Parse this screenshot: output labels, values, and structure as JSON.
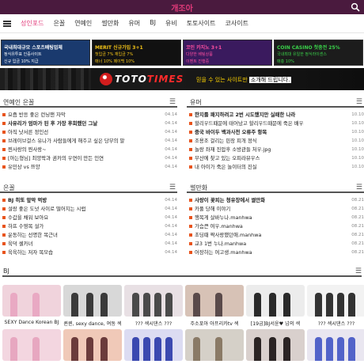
{
  "header": {
    "site_title": "개조아",
    "search_icon": "search-icon",
    "menu_icon": "hamburger-icon"
  },
  "nav": {
    "items": [
      {
        "label": "성인포드",
        "active": true
      },
      {
        "label": "은꼴",
        "active": false
      },
      {
        "label": "연예인",
        "active": false
      },
      {
        "label": "썰만화",
        "active": false
      },
      {
        "label": "유머",
        "active": false
      },
      {
        "label": "BJ",
        "active": false
      },
      {
        "label": "유비",
        "active": false
      },
      {
        "label": "토토사이트",
        "active": false
      },
      {
        "label": "코사이트",
        "active": false
      }
    ]
  },
  "banners": [
    {
      "l1": "국내최대규모 스포츠배팅업체",
      "l2": "정식유투표 인증사이트",
      "l3": "신규 입금 10% 지급",
      "bg": "#1a3a6e",
      "fg": "#ffffff"
    },
    {
      "l1": "MERIT 신규가입 3+1",
      "l2": "첫입금 7% 재입금 7%",
      "l3": "매너 10% 페이백 10%",
      "bg": "#111111",
      "fg": "#f5c518"
    },
    {
      "l1": "코인 카지노 3+1",
      "l2": "다양한 베팅상품",
      "l3": "이벤트 진행중",
      "bg": "#3a1a5e",
      "fg": "#ff4fa0"
    },
    {
      "l1": "COIN CASINO 첫충전 25%",
      "l2": "국내최대 유일한 정식라이센스",
      "l3": "매충 10%",
      "bg": "#1c1c1c",
      "fg": "#3ad24a"
    }
  ],
  "promo": {
    "brand_main": "TOTO",
    "brand_accent": "TIMES",
    "slogan_highlight": "믿을 수 있는 사이트만",
    "slogan_box": "소개해 드립니다."
  },
  "sections": {
    "celeb": {
      "title": "연예인 은꼴",
      "items": [
        {
          "title": "요즘 반응 좋은 런닝맨 자막",
          "date": "04.14",
          "bold": false
        },
        {
          "title": "사유리가 엄마가 된 후 가장 후회했던 그날",
          "date": "04.14",
          "bold": true
        },
        {
          "title": "아직 낫서른 정인선",
          "date": "04.14",
          "bold": false
        },
        {
          "title": "브레이브걸스 유나가 사람들에게 해주고 싶은 당부의 말",
          "date": "04.14",
          "bold": false
        },
        {
          "title": "찐사랑의 찐사랑~",
          "date": "04.14",
          "bold": false
        },
        {
          "title": "[아는형님] 최양락과 권카의 우연이 만든 인연",
          "date": "04.14",
          "bold": false
        },
        {
          "title": "유민상 vs 쯔양",
          "date": "04.14",
          "bold": false
        }
      ]
    },
    "humor": {
      "title": "유머",
      "items": [
        {
          "title": "한지를 패지하려고 2번 시도했지만 실패한 나라",
          "date": "10.10",
          "bold": true
        },
        {
          "title": "할리우드때문에 태어났고 할리우드때문에 죽은 배우",
          "date": "10.10",
          "bold": false
        },
        {
          "title": "중국 바이두 백과사전 오류주 항목",
          "date": "10.10",
          "bold": true
        },
        {
          "title": "조용조 걸리는 핀장 피개 정식",
          "date": "10.10",
          "bold": false
        },
        {
          "title": "놀랑 좌재 진압후 소방관들 처우.jpg",
          "date": "10.10",
          "bold": false
        },
        {
          "title": "부산에 찾고 있는 오피라뷰우스",
          "date": "10.10",
          "bold": false
        },
        {
          "title": "내 아이가 죽은 놀이터의 진실",
          "date": "10.10",
          "bold": false
        }
      ]
    },
    "eungol": {
      "title": "은꼴",
      "items": [
        {
          "title": "BJ 히또 앞막 먹방",
          "date": "04.14",
          "bold": true
        },
        {
          "title": "설랑 좋은 도넛 사이로 떨어지는 시럽",
          "date": "04.14",
          "bold": false
        },
        {
          "title": "수갑을 채워 보아요",
          "date": "04.14",
          "bold": false
        },
        {
          "title": "하프 수영복 설가",
          "date": "04.14",
          "bold": false
        },
        {
          "title": "운동하는 선명한 복근녀",
          "date": "04.14",
          "bold": false
        },
        {
          "title": "육덕 셀카녀",
          "date": "04.14",
          "bold": false
        },
        {
          "title": "육육하는 저자 목모습",
          "date": "04.14",
          "bold": false
        }
      ]
    },
    "manhwa": {
      "title": "썰만화",
      "items": [
        {
          "title": "사랑이 꽃피는 청유장에서 썰만화",
          "date": "08.21",
          "bold": true
        },
        {
          "title": "카풀 당해 이야기",
          "date": "08.21",
          "bold": false
        },
        {
          "title": "행복게 살바누나.manhwa",
          "date": "08.21",
          "bold": false
        },
        {
          "title": "가슴큰 여우.manhwa",
          "date": "08.21",
          "bold": false
        },
        {
          "title": "초딩때 짝사랑했던애.manhwa",
          "date": "08.21",
          "bold": false
        },
        {
          "title": "교3 1번 누나.manhwa",
          "date": "08.21",
          "bold": false
        },
        {
          "title": "어장하는 여고생.manhwa",
          "date": "08.21",
          "bold": false
        }
      ]
    }
  },
  "bj": {
    "title": "BJ",
    "row1": [
      {
        "caption": "SEXY Dance Korean BJ",
        "c1": "#f0d3dc",
        "c2": "#e9a9c3"
      },
      {
        "caption": "퀸퀸, sexy dance, 여동 섹",
        "c1": "#d8d8d8",
        "c2": "#3a3a3a"
      },
      {
        "caption": "??? 섹시댄스 ???",
        "c1": "#e8e0e4",
        "c2": "#4a4a4a"
      },
      {
        "caption": "주소포아 아프리카tv 섹",
        "c1": "#d7c2b6",
        "c2": "#5a4a4a"
      },
      {
        "caption": "[19금]BJ서윤♥ 넘의 섹",
        "c1": "#ececec",
        "c2": "#2a2a2a"
      },
      {
        "caption": "??? 섹시댄스 ???",
        "c1": "#f2f2f2",
        "c2": "#333333"
      }
    ],
    "row2": [
      {
        "c1": "#f3d6e0",
        "c2": "#e7a7c0"
      },
      {
        "c1": "#f0c9b8",
        "c2": "#6b3b3b"
      },
      {
        "c1": "#dcdcf2",
        "c2": "#3b49b0"
      },
      {
        "c1": "#d5d0c8",
        "c2": "#8a7a66"
      },
      {
        "c1": "#d9d0cd",
        "c2": "#2b2424"
      },
      {
        "c1": "#e9e6f0",
        "c2": "#5263c9"
      }
    ]
  }
}
